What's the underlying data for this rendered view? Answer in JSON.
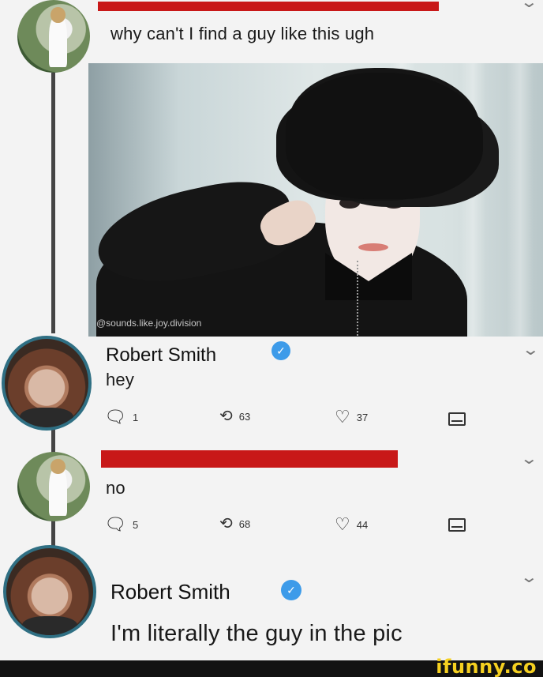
{
  "tweets": [
    {
      "text": "why can't I find a guy like this ugh",
      "redacted_name": true,
      "photo": {
        "watermark": "@sounds.like.joy.division"
      }
    },
    {
      "name": "Robert Smith",
      "verified": true,
      "text": "hey",
      "stats": {
        "replies": "1",
        "retweets": "63",
        "likes": "37"
      }
    },
    {
      "redacted_name": true,
      "text": "no",
      "stats": {
        "replies": "5",
        "retweets": "68",
        "likes": "44"
      }
    },
    {
      "name": "Robert Smith",
      "verified": true,
      "text": "I'm literally the guy in the pic"
    }
  ],
  "icons": {
    "chevron": "⌄",
    "verified": "✓",
    "reply": "🗨",
    "retweet": "⟲",
    "like": "♡"
  },
  "branding": {
    "logo": "ifunny.co"
  },
  "colors": {
    "redaction": "#c81818",
    "verified": "#3d9be9",
    "avatar_ring": "#2f6f83",
    "logo": "#f5d020"
  }
}
